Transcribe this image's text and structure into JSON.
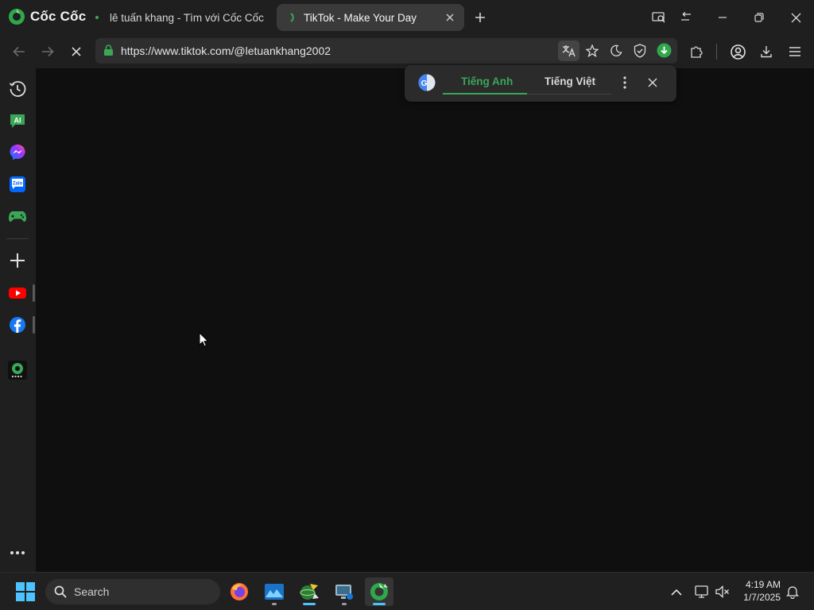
{
  "browser": {
    "brand": "Cốc Cốc",
    "tabs": [
      {
        "title": "lê tuấn khang - Tìm với Cốc Cốc",
        "active": false
      },
      {
        "title": "TikTok - Make Your Day",
        "active": true
      }
    ],
    "url": "https://www.tiktok.com/@letuankhang2002"
  },
  "translate_popup": {
    "source_lang": "Tiếng Anh",
    "target_lang": "Tiếng Việt"
  },
  "sidebar": {
    "items": [
      "history-icon",
      "ai-icon",
      "messenger-icon",
      "zalo-icon",
      "games-icon",
      "add-icon",
      "youtube-icon",
      "facebook-icon",
      "coccoc-2024-icon",
      "more-icon"
    ]
  },
  "taskbar": {
    "search_label": "Search",
    "time": "4:19 AM",
    "date": "1/7/2025"
  },
  "colors": {
    "accent": "#3aa757",
    "background": "#1f1f1f",
    "content": "#0f0f0f"
  }
}
